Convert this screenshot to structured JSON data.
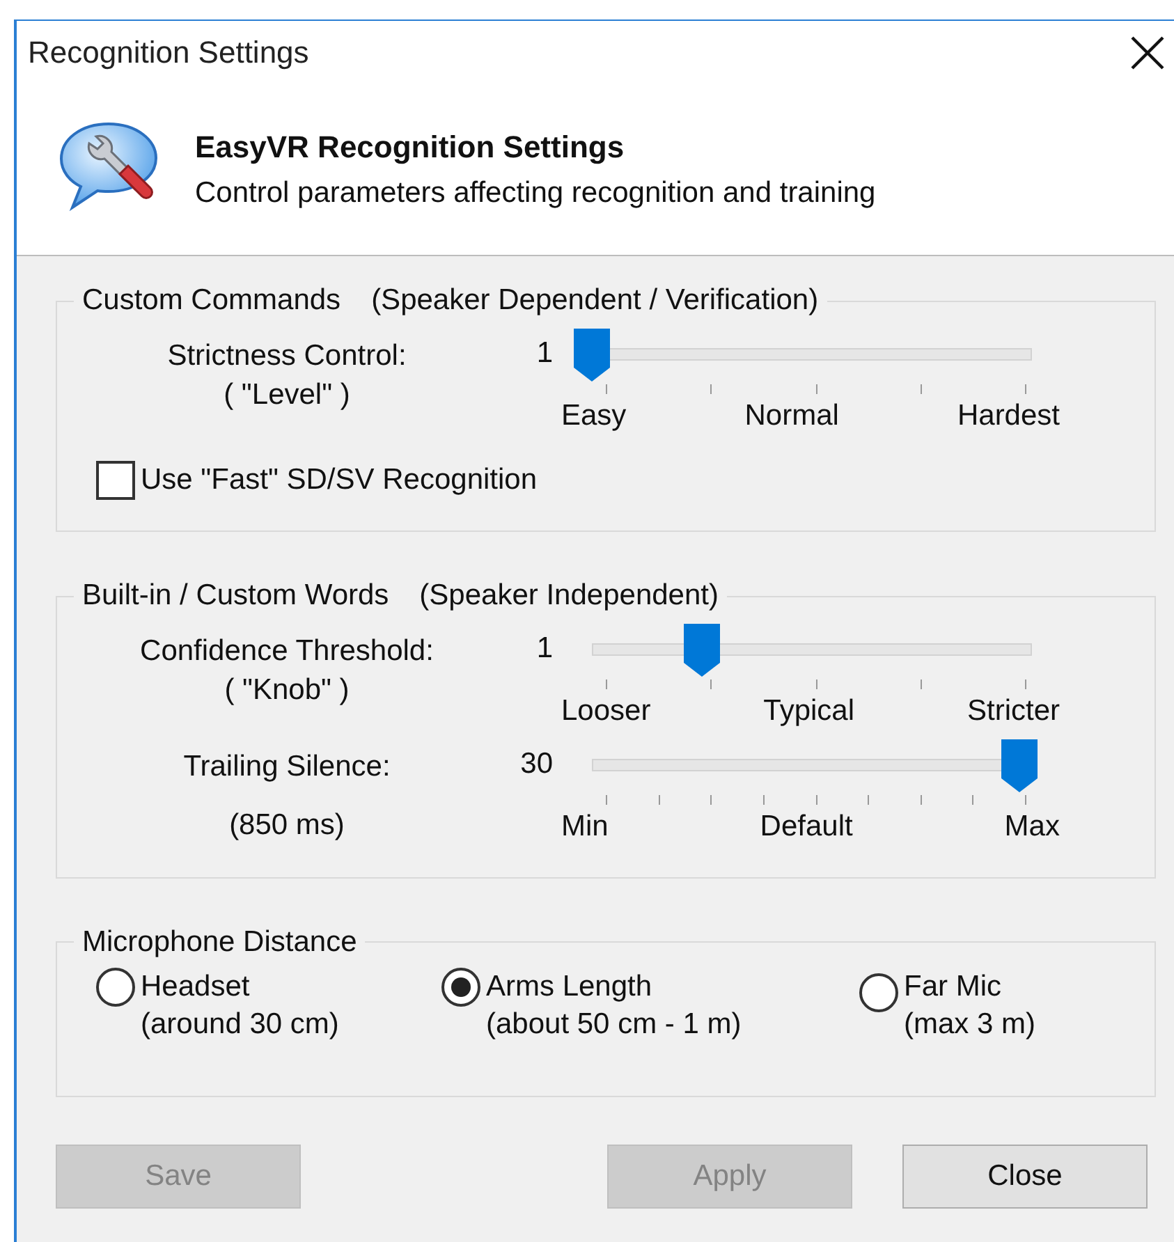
{
  "window": {
    "title": "Recognition Settings"
  },
  "header": {
    "title": "EasyVR Recognition Settings",
    "subtitle": "Control parameters affecting recognition and training"
  },
  "groups": [
    {
      "title": "Custom Commands",
      "note": "(Speaker Dependent / Verification)",
      "sliders": [
        {
          "kind": "coarse",
          "label": "Strictness Control:",
          "sublabel": "( \"Level\" )",
          "value": "1",
          "level": 0,
          "ticks": [
            "Easy",
            "Normal",
            "Hardest"
          ]
        }
      ],
      "checkbox": {
        "label": "Use \"Fast\" SD/SV Recognition",
        "checked": false
      }
    },
    {
      "title": "Built-in / Custom Words",
      "note": "(Speaker Independent)",
      "sliders": [
        {
          "kind": "coarse",
          "label": "Confidence Threshold:",
          "sublabel": "( \"Knob\" )",
          "value": "1",
          "level": 0.25,
          "ticks": [
            "Looser",
            "Typical",
            "Stricter"
          ]
        },
        {
          "kind": "fine",
          "label": "Trailing Silence:",
          "sublabel": "(850 ms)",
          "value": "30",
          "level": 0.97,
          "ticks": [
            "Min",
            "Default",
            "Max"
          ]
        }
      ]
    }
  ],
  "microphone": {
    "title": "Microphone Distance",
    "options": [
      {
        "label": "Headset",
        "sublabel": "(around 30 cm)",
        "selected": false
      },
      {
        "label": "Arms Length",
        "sublabel": "(about 50 cm - 1 m)",
        "selected": true
      },
      {
        "label": "Far Mic",
        "sublabel": "(max 3 m)",
        "selected": false
      }
    ]
  },
  "buttons": [
    {
      "label": "Save",
      "disabled": true
    },
    {
      "label": "Apply",
      "disabled": true
    },
    {
      "label": "Close",
      "disabled": false
    }
  ]
}
